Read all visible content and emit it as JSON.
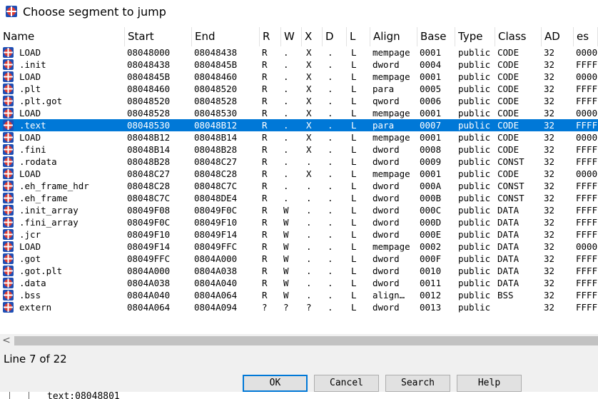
{
  "window": {
    "title": "Choose segment to jump",
    "icon": "segment-icon"
  },
  "columns": [
    "Name",
    "Start",
    "End",
    "R",
    "W",
    "X",
    "D",
    "L",
    "Align",
    "Base",
    "Type",
    "Class",
    "AD",
    "es"
  ],
  "rows": [
    {
      "name": "LOAD",
      "start": "08048000",
      "end": "08048438",
      "r": "R",
      "w": ".",
      "x": "X",
      "d": ".",
      "l": "L",
      "align": "mempage",
      "base": "0001",
      "type": "public",
      "class": "CODE",
      "ad": "32",
      "es": "0000"
    },
    {
      "name": ".init",
      "start": "08048438",
      "end": "0804845B",
      "r": "R",
      "w": ".",
      "x": "X",
      "d": ".",
      "l": "L",
      "align": "dword",
      "base": "0004",
      "type": "public",
      "class": "CODE",
      "ad": "32",
      "es": "FFFF"
    },
    {
      "name": "LOAD",
      "start": "0804845B",
      "end": "08048460",
      "r": "R",
      "w": ".",
      "x": "X",
      "d": ".",
      "l": "L",
      "align": "mempage",
      "base": "0001",
      "type": "public",
      "class": "CODE",
      "ad": "32",
      "es": "0000"
    },
    {
      "name": ".plt",
      "start": "08048460",
      "end": "08048520",
      "r": "R",
      "w": ".",
      "x": "X",
      "d": ".",
      "l": "L",
      "align": "para",
      "base": "0005",
      "type": "public",
      "class": "CODE",
      "ad": "32",
      "es": "FFFF"
    },
    {
      "name": ".plt.got",
      "start": "08048520",
      "end": "08048528",
      "r": "R",
      "w": ".",
      "x": "X",
      "d": ".",
      "l": "L",
      "align": "qword",
      "base": "0006",
      "type": "public",
      "class": "CODE",
      "ad": "32",
      "es": "FFFF"
    },
    {
      "name": "LOAD",
      "start": "08048528",
      "end": "08048530",
      "r": "R",
      "w": ".",
      "x": "X",
      "d": ".",
      "l": "L",
      "align": "mempage",
      "base": "0001",
      "type": "public",
      "class": "CODE",
      "ad": "32",
      "es": "0000"
    },
    {
      "name": ".text",
      "start": "08048530",
      "end": "08048B12",
      "r": "R",
      "w": ".",
      "x": "X",
      "d": ".",
      "l": "L",
      "align": "para",
      "base": "0007",
      "type": "public",
      "class": "CODE",
      "ad": "32",
      "es": "FFFF"
    },
    {
      "name": "LOAD",
      "start": "08048B12",
      "end": "08048B14",
      "r": "R",
      "w": ".",
      "x": "X",
      "d": ".",
      "l": "L",
      "align": "mempage",
      "base": "0001",
      "type": "public",
      "class": "CODE",
      "ad": "32",
      "es": "0000"
    },
    {
      "name": ".fini",
      "start": "08048B14",
      "end": "08048B28",
      "r": "R",
      "w": ".",
      "x": "X",
      "d": ".",
      "l": "L",
      "align": "dword",
      "base": "0008",
      "type": "public",
      "class": "CODE",
      "ad": "32",
      "es": "FFFF"
    },
    {
      "name": ".rodata",
      "start": "08048B28",
      "end": "08048C27",
      "r": "R",
      "w": ".",
      "x": ".",
      "d": ".",
      "l": "L",
      "align": "dword",
      "base": "0009",
      "type": "public",
      "class": "CONST",
      "ad": "32",
      "es": "FFFF"
    },
    {
      "name": "LOAD",
      "start": "08048C27",
      "end": "08048C28",
      "r": "R",
      "w": ".",
      "x": "X",
      "d": ".",
      "l": "L",
      "align": "mempage",
      "base": "0001",
      "type": "public",
      "class": "CODE",
      "ad": "32",
      "es": "0000"
    },
    {
      "name": ".eh_frame_hdr",
      "start": "08048C28",
      "end": "08048C7C",
      "r": "R",
      "w": ".",
      "x": ".",
      "d": ".",
      "l": "L",
      "align": "dword",
      "base": "000A",
      "type": "public",
      "class": "CONST",
      "ad": "32",
      "es": "FFFF"
    },
    {
      "name": ".eh_frame",
      "start": "08048C7C",
      "end": "08048DE4",
      "r": "R",
      "w": ".",
      "x": ".",
      "d": ".",
      "l": "L",
      "align": "dword",
      "base": "000B",
      "type": "public",
      "class": "CONST",
      "ad": "32",
      "es": "FFFF"
    },
    {
      "name": ".init_array",
      "start": "08049F08",
      "end": "08049F0C",
      "r": "R",
      "w": "W",
      "x": ".",
      "d": ".",
      "l": "L",
      "align": "dword",
      "base": "000C",
      "type": "public",
      "class": "DATA",
      "ad": "32",
      "es": "FFFF"
    },
    {
      "name": ".fini_array",
      "start": "08049F0C",
      "end": "08049F10",
      "r": "R",
      "w": "W",
      "x": ".",
      "d": ".",
      "l": "L",
      "align": "dword",
      "base": "000D",
      "type": "public",
      "class": "DATA",
      "ad": "32",
      "es": "FFFF"
    },
    {
      "name": ".jcr",
      "start": "08049F10",
      "end": "08049F14",
      "r": "R",
      "w": "W",
      "x": ".",
      "d": ".",
      "l": "L",
      "align": "dword",
      "base": "000E",
      "type": "public",
      "class": "DATA",
      "ad": "32",
      "es": "FFFF"
    },
    {
      "name": "LOAD",
      "start": "08049F14",
      "end": "08049FFC",
      "r": "R",
      "w": "W",
      "x": ".",
      "d": ".",
      "l": "L",
      "align": "mempage",
      "base": "0002",
      "type": "public",
      "class": "DATA",
      "ad": "32",
      "es": "0000"
    },
    {
      "name": ".got",
      "start": "08049FFC",
      "end": "0804A000",
      "r": "R",
      "w": "W",
      "x": ".",
      "d": ".",
      "l": "L",
      "align": "dword",
      "base": "000F",
      "type": "public",
      "class": "DATA",
      "ad": "32",
      "es": "FFFF"
    },
    {
      "name": ".got.plt",
      "start": "0804A000",
      "end": "0804A038",
      "r": "R",
      "w": "W",
      "x": ".",
      "d": ".",
      "l": "L",
      "align": "dword",
      "base": "0010",
      "type": "public",
      "class": "DATA",
      "ad": "32",
      "es": "FFFF"
    },
    {
      "name": ".data",
      "start": "0804A038",
      "end": "0804A040",
      "r": "R",
      "w": "W",
      "x": ".",
      "d": ".",
      "l": "L",
      "align": "dword",
      "base": "0011",
      "type": "public",
      "class": "DATA",
      "ad": "32",
      "es": "FFFF"
    },
    {
      "name": ".bss",
      "start": "0804A040",
      "end": "0804A064",
      "r": "R",
      "w": "W",
      "x": ".",
      "d": ".",
      "l": "L",
      "align": "align…",
      "base": "0012",
      "type": "public",
      "class": "BSS",
      "ad": "32",
      "es": "FFFF"
    },
    {
      "name": "extern",
      "start": "0804A064",
      "end": "0804A094",
      "r": "?",
      "w": "?",
      "x": "?",
      "d": ".",
      "l": "L",
      "align": "dword",
      "base": "0013",
      "type": "public",
      "class": "",
      "ad": "32",
      "es": "FFFF"
    }
  ],
  "selected_index": 6,
  "scrollbar": {
    "left_arrow": "<"
  },
  "status": {
    "line_text": "Line 7 of 22"
  },
  "buttons": {
    "ok": "OK",
    "cancel": "Cancel",
    "search": "Search",
    "help": "Help"
  },
  "background_peek": {
    "text": "text:08048801"
  },
  "colors": {
    "selection": "#0078d7",
    "icon_red": "#e03c31",
    "icon_blue": "#1f4fb5"
  }
}
